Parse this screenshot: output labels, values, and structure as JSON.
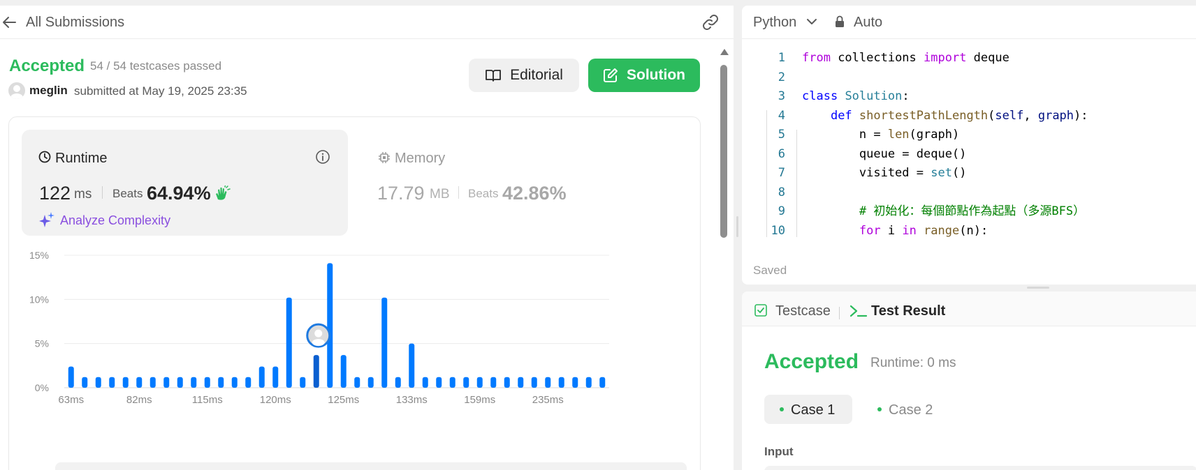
{
  "submission": {
    "back_label": "All Submissions",
    "status": "Accepted",
    "testcases": "54 / 54 testcases passed",
    "author": "meglin",
    "submitted_at": "submitted at May 19, 2025 23:35",
    "editorial_label": "Editorial",
    "solution_label": "Solution"
  },
  "runtime": {
    "label": "Runtime",
    "value": "122",
    "unit": "ms",
    "beats_label": "Beats",
    "beats_value": "64.94%",
    "analyze_label": "Analyze Complexity"
  },
  "memory": {
    "label": "Memory",
    "value": "17.79",
    "unit": "MB",
    "beats_label": "Beats",
    "beats_value": "42.86%"
  },
  "chart_data": {
    "type": "bar",
    "ylabel": "",
    "xlabel": "",
    "ylim": [
      0,
      15
    ],
    "y_ticks": [
      "0%",
      "5%",
      "10%",
      "15%"
    ],
    "y_tick_values": [
      0,
      5,
      10,
      15
    ],
    "x_ticks": [
      "63ms",
      "82ms",
      "115ms",
      "120ms",
      "125ms",
      "133ms",
      "159ms",
      "235ms"
    ],
    "x_tick_bar_index": [
      0,
      5,
      10,
      15,
      20,
      25,
      30,
      35
    ],
    "values": [
      2.4,
      1.2,
      1.2,
      1.2,
      1.2,
      1.2,
      1.2,
      1.2,
      1.2,
      1.2,
      1.2,
      1.2,
      1.2,
      1.2,
      2.4,
      2.4,
      10.2,
      1.2,
      3.7,
      14.1,
      3.7,
      1.2,
      1.2,
      10.2,
      1.2,
      5.0,
      1.2,
      1.2,
      1.2,
      1.2,
      1.2,
      1.2,
      1.2,
      1.2,
      1.2,
      1.2,
      1.2,
      1.2,
      1.2,
      1.2
    ],
    "highlight_index": 18,
    "bar_color": "#007aff",
    "highlight_color": "#0a5fd0"
  },
  "editor": {
    "language": "Python",
    "mode": "Auto",
    "saved_label": "Saved",
    "lines": [
      {
        "n": "1",
        "tokens": [
          [
            "kw",
            "from"
          ],
          [
            "",
            " collections "
          ],
          [
            "kw",
            "import"
          ],
          [
            "",
            " deque"
          ]
        ]
      },
      {
        "n": "2",
        "tokens": []
      },
      {
        "n": "3",
        "tokens": [
          [
            "kw2",
            "class"
          ],
          [
            "",
            " "
          ],
          [
            "cls",
            "Solution"
          ],
          [
            "",
            ":"
          ]
        ]
      },
      {
        "n": "4",
        "tokens": [
          [
            "",
            "    "
          ],
          [
            "kw2",
            "def"
          ],
          [
            "",
            " "
          ],
          [
            "fn",
            "shortestPathLength"
          ],
          [
            "",
            "("
          ],
          [
            "par",
            "self"
          ],
          [
            "",
            ", "
          ],
          [
            "par",
            "graph"
          ],
          [
            "",
            "):"
          ]
        ]
      },
      {
        "n": "5",
        "tokens": [
          [
            "",
            "        n = "
          ],
          [
            "fn",
            "len"
          ],
          [
            "",
            "(graph)"
          ]
        ]
      },
      {
        "n": "6",
        "tokens": [
          [
            "",
            "        queue = deque()"
          ]
        ]
      },
      {
        "n": "7",
        "tokens": [
          [
            "",
            "        visited = "
          ],
          [
            "cls",
            "set"
          ],
          [
            "",
            "()"
          ]
        ]
      },
      {
        "n": "8",
        "tokens": []
      },
      {
        "n": "9",
        "tokens": [
          [
            "",
            "        "
          ],
          [
            "cmt",
            "# 初始化：每個節點作為起點（多源BFS）"
          ]
        ]
      },
      {
        "n": "10",
        "tokens": [
          [
            "",
            "        "
          ],
          [
            "kw",
            "for"
          ],
          [
            "",
            " i "
          ],
          [
            "kw",
            "in"
          ],
          [
            "",
            " "
          ],
          [
            "fn",
            "range"
          ],
          [
            "",
            "(n):"
          ]
        ]
      }
    ]
  },
  "tests": {
    "testcase_tab": "Testcase",
    "result_tab": "Test Result",
    "status": "Accepted",
    "runtime": "Runtime: 0 ms",
    "case1": "Case 1",
    "case2": "Case 2",
    "input_label": "Input"
  },
  "colors": {
    "accent_green": "#2cbb5d",
    "bar_blue": "#007aff",
    "analyze_purple": "#8a4fdf"
  }
}
